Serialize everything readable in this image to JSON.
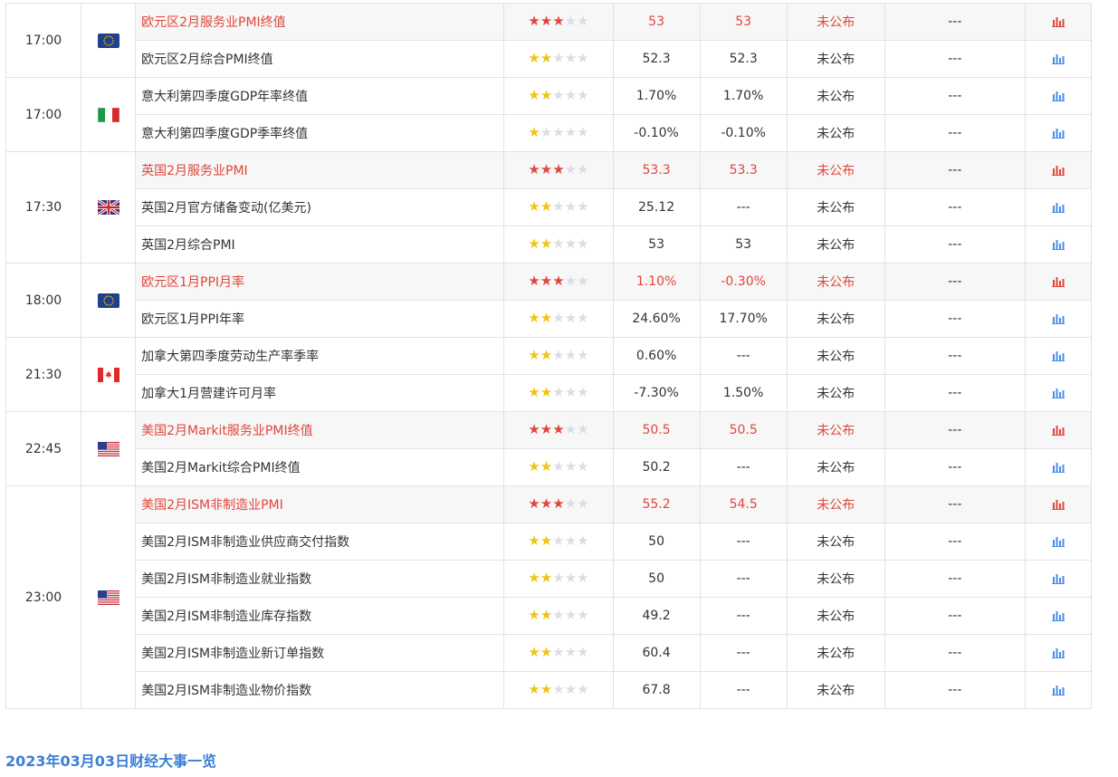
{
  "colors": {
    "important": "#e0463b",
    "star_on": "#f2c315",
    "star_off": "#dcdde2",
    "chart_blue": "#4a8ee8",
    "link": "#3b7fd6"
  },
  "groups": [
    {
      "time": "17:00",
      "flag": "eu-flag",
      "rows": [
        {
          "name": "欧元区2月服务业PMI终值",
          "stars": 3,
          "important": true,
          "previous": "53",
          "forecast": "53",
          "actual": "未公布",
          "impact": "---"
        },
        {
          "name": "欧元区2月综合PMI终值",
          "stars": 2,
          "important": false,
          "previous": "52.3",
          "forecast": "52.3",
          "actual": "未公布",
          "impact": "---"
        }
      ]
    },
    {
      "time": "17:00",
      "flag": "italy-flag",
      "rows": [
        {
          "name": "意大利第四季度GDP年率终值",
          "stars": 2,
          "important": false,
          "previous": "1.70%",
          "forecast": "1.70%",
          "actual": "未公布",
          "impact": "---"
        },
        {
          "name": "意大利第四季度GDP季率终值",
          "stars": 1,
          "important": false,
          "previous": "-0.10%",
          "forecast": "-0.10%",
          "actual": "未公布",
          "impact": "---"
        }
      ]
    },
    {
      "time": "17:30",
      "flag": "uk-flag",
      "rows": [
        {
          "name": "英国2月服务业PMI",
          "stars": 3,
          "important": true,
          "previous": "53.3",
          "forecast": "53.3",
          "actual": "未公布",
          "impact": "---"
        },
        {
          "name": "英国2月官方储备变动(亿美元)",
          "stars": 2,
          "important": false,
          "previous": "25.12",
          "forecast": "---",
          "actual": "未公布",
          "impact": "---"
        },
        {
          "name": "英国2月综合PMI",
          "stars": 2,
          "important": false,
          "previous": "53",
          "forecast": "53",
          "actual": "未公布",
          "impact": "---"
        }
      ]
    },
    {
      "time": "18:00",
      "flag": "eu-flag",
      "rows": [
        {
          "name": "欧元区1月PPI月率",
          "stars": 3,
          "important": true,
          "previous": "1.10%",
          "forecast": "-0.30%",
          "actual": "未公布",
          "impact": "---"
        },
        {
          "name": "欧元区1月PPI年率",
          "stars": 2,
          "important": false,
          "previous": "24.60%",
          "forecast": "17.70%",
          "actual": "未公布",
          "impact": "---"
        }
      ]
    },
    {
      "time": "21:30",
      "flag": "canada-flag",
      "rows": [
        {
          "name": "加拿大第四季度劳动生产率季率",
          "stars": 2,
          "important": false,
          "previous": "0.60%",
          "forecast": "---",
          "actual": "未公布",
          "impact": "---"
        },
        {
          "name": "加拿大1月营建许可月率",
          "stars": 2,
          "important": false,
          "previous": "-7.30%",
          "forecast": "1.50%",
          "actual": "未公布",
          "impact": "---"
        }
      ]
    },
    {
      "time": "22:45",
      "flag": "us-flag",
      "rows": [
        {
          "name": "美国2月Markit服务业PMI终值",
          "stars": 3,
          "important": true,
          "previous": "50.5",
          "forecast": "50.5",
          "actual": "未公布",
          "impact": "---"
        },
        {
          "name": "美国2月Markit综合PMI终值",
          "stars": 2,
          "important": false,
          "previous": "50.2",
          "forecast": "---",
          "actual": "未公布",
          "impact": "---"
        }
      ]
    },
    {
      "time": "23:00",
      "flag": "us-flag",
      "rows": [
        {
          "name": "美国2月ISM非制造业PMI",
          "stars": 3,
          "important": true,
          "previous": "55.2",
          "forecast": "54.5",
          "actual": "未公布",
          "impact": "---"
        },
        {
          "name": "美国2月ISM非制造业供应商交付指数",
          "stars": 2,
          "important": false,
          "previous": "50",
          "forecast": "---",
          "actual": "未公布",
          "impact": "---"
        },
        {
          "name": "美国2月ISM非制造业就业指数",
          "stars": 2,
          "important": false,
          "previous": "50",
          "forecast": "---",
          "actual": "未公布",
          "impact": "---"
        },
        {
          "name": "美国2月ISM非制造业库存指数",
          "stars": 2,
          "important": false,
          "previous": "49.2",
          "forecast": "---",
          "actual": "未公布",
          "impact": "---"
        },
        {
          "name": "美国2月ISM非制造业新订单指数",
          "stars": 2,
          "important": false,
          "previous": "60.4",
          "forecast": "---",
          "actual": "未公布",
          "impact": "---"
        },
        {
          "name": "美国2月ISM非制造业物价指数",
          "stars": 2,
          "important": false,
          "previous": "67.8",
          "forecast": "---",
          "actual": "未公布",
          "impact": "---"
        }
      ]
    }
  ],
  "footer": {
    "title": "2023年03月03日财经大事一览"
  }
}
